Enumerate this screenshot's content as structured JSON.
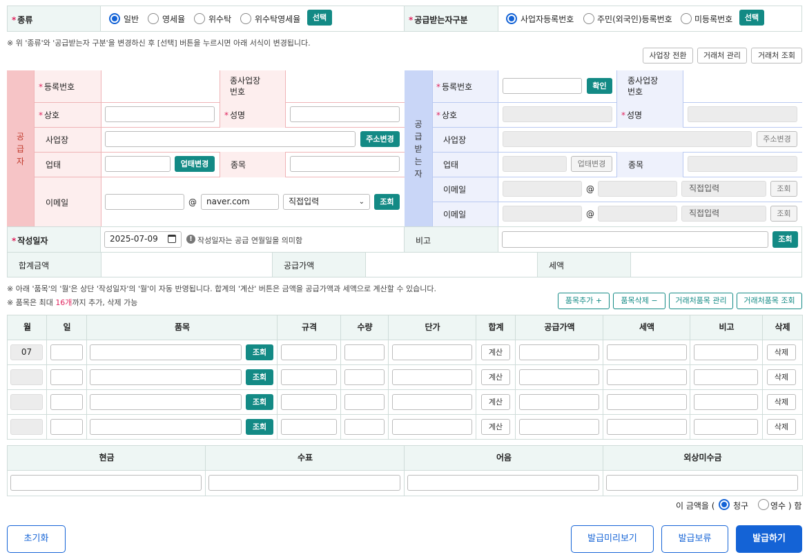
{
  "type_row": {
    "label": "종류",
    "options": [
      "일반",
      "영세율",
      "위수탁",
      "위수탁영세율"
    ],
    "selected": "일반",
    "select_btn": "선택"
  },
  "recv_row": {
    "label": "공급받는자구분",
    "options": [
      "사업자등록번호",
      "주민(외국인)등록번호",
      "미등록번호"
    ],
    "selected": "사업자등록번호",
    "select_btn": "선택"
  },
  "notice1": "※ 위 '종류'와 '공급받는자 구분'을 변경하신 후 [선택] 버튼을 누르시면 아래 서식이 변경됩니다.",
  "top_buttons": [
    "사업장 전환",
    "거래처 관리",
    "거래처 조회"
  ],
  "supplier": {
    "title": "공\n급\n자",
    "reg_no": "등록번호",
    "sub_biz": "종사업장\n번호",
    "name": "상호",
    "ceo": "성명",
    "address": "사업장",
    "addr_btn": "주소변경",
    "biz_type": "업태",
    "biz_type_btn": "업태변경",
    "biz_item": "종목",
    "email": "이메일",
    "at": "@",
    "domain": "naver.com",
    "domain_select": "직접입력",
    "lookup": "조회"
  },
  "receiver": {
    "title": "공\n급\n받\n는\n자",
    "reg_no": "등록번호",
    "confirm_btn": "확인",
    "sub_biz": "종사업장\n번호",
    "name": "상호",
    "ceo": "성명",
    "address": "사업장",
    "addr_btn": "주소변경",
    "biz_type": "업태",
    "biz_type_btn": "업태변경",
    "biz_item": "종목",
    "email1": "이메일",
    "email2": "이메일",
    "at": "@",
    "domain_select": "직접입력",
    "lookup": "조회"
  },
  "date_row": {
    "label": "작성일자",
    "value": "2025-07-09",
    "hint": "작성일자는 공급 연월일을 의미함",
    "remark": "비고",
    "lookup": "조회"
  },
  "sum_row": {
    "total": "합계금액",
    "supply": "공급가액",
    "tax": "세액"
  },
  "notice2": "※ 아래 '품목'의 '월'은 상단 '작성일자'의 '월'이 자동 반영됩니다. 합계의 '계산' 버튼은 금액을 공급가액과 세액으로 계산할 수 있습니다.",
  "notice3": {
    "prefix": "※ 품목은 최대 ",
    "count": "16개",
    "suffix": "까지 추가, 삭제 가능"
  },
  "item_buttons": {
    "add": "품목추가 +",
    "del": "품목삭제 −",
    "manage": "거래처품목 관리",
    "lookup": "거래처품목 조회"
  },
  "item_headers": [
    "월",
    "일",
    "품목",
    "규격",
    "수량",
    "단가",
    "합계",
    "공급가액",
    "세액",
    "비고",
    "삭제"
  ],
  "item_rows": [
    {
      "month": "07"
    },
    {
      "month": ""
    },
    {
      "month": ""
    },
    {
      "month": ""
    }
  ],
  "row_labels": {
    "lookup": "조회",
    "calc": "계산",
    "delete": "삭제"
  },
  "pay_headers": [
    "현금",
    "수표",
    "어음",
    "외상미수금"
  ],
  "claim": {
    "prefix": "이 금액을 (",
    "opt1": "청구",
    "opt2": "영수 ) 함",
    "selected": "청구"
  },
  "bottom": {
    "reset": "초기화",
    "preview": "발급미리보기",
    "hold": "발급보류",
    "issue": "발급하기"
  },
  "colors": {
    "teal": "#138a85",
    "blue": "#1463d6",
    "supplier_red": "#f4c2c4",
    "receiver_blue": "#c9d6f7"
  }
}
